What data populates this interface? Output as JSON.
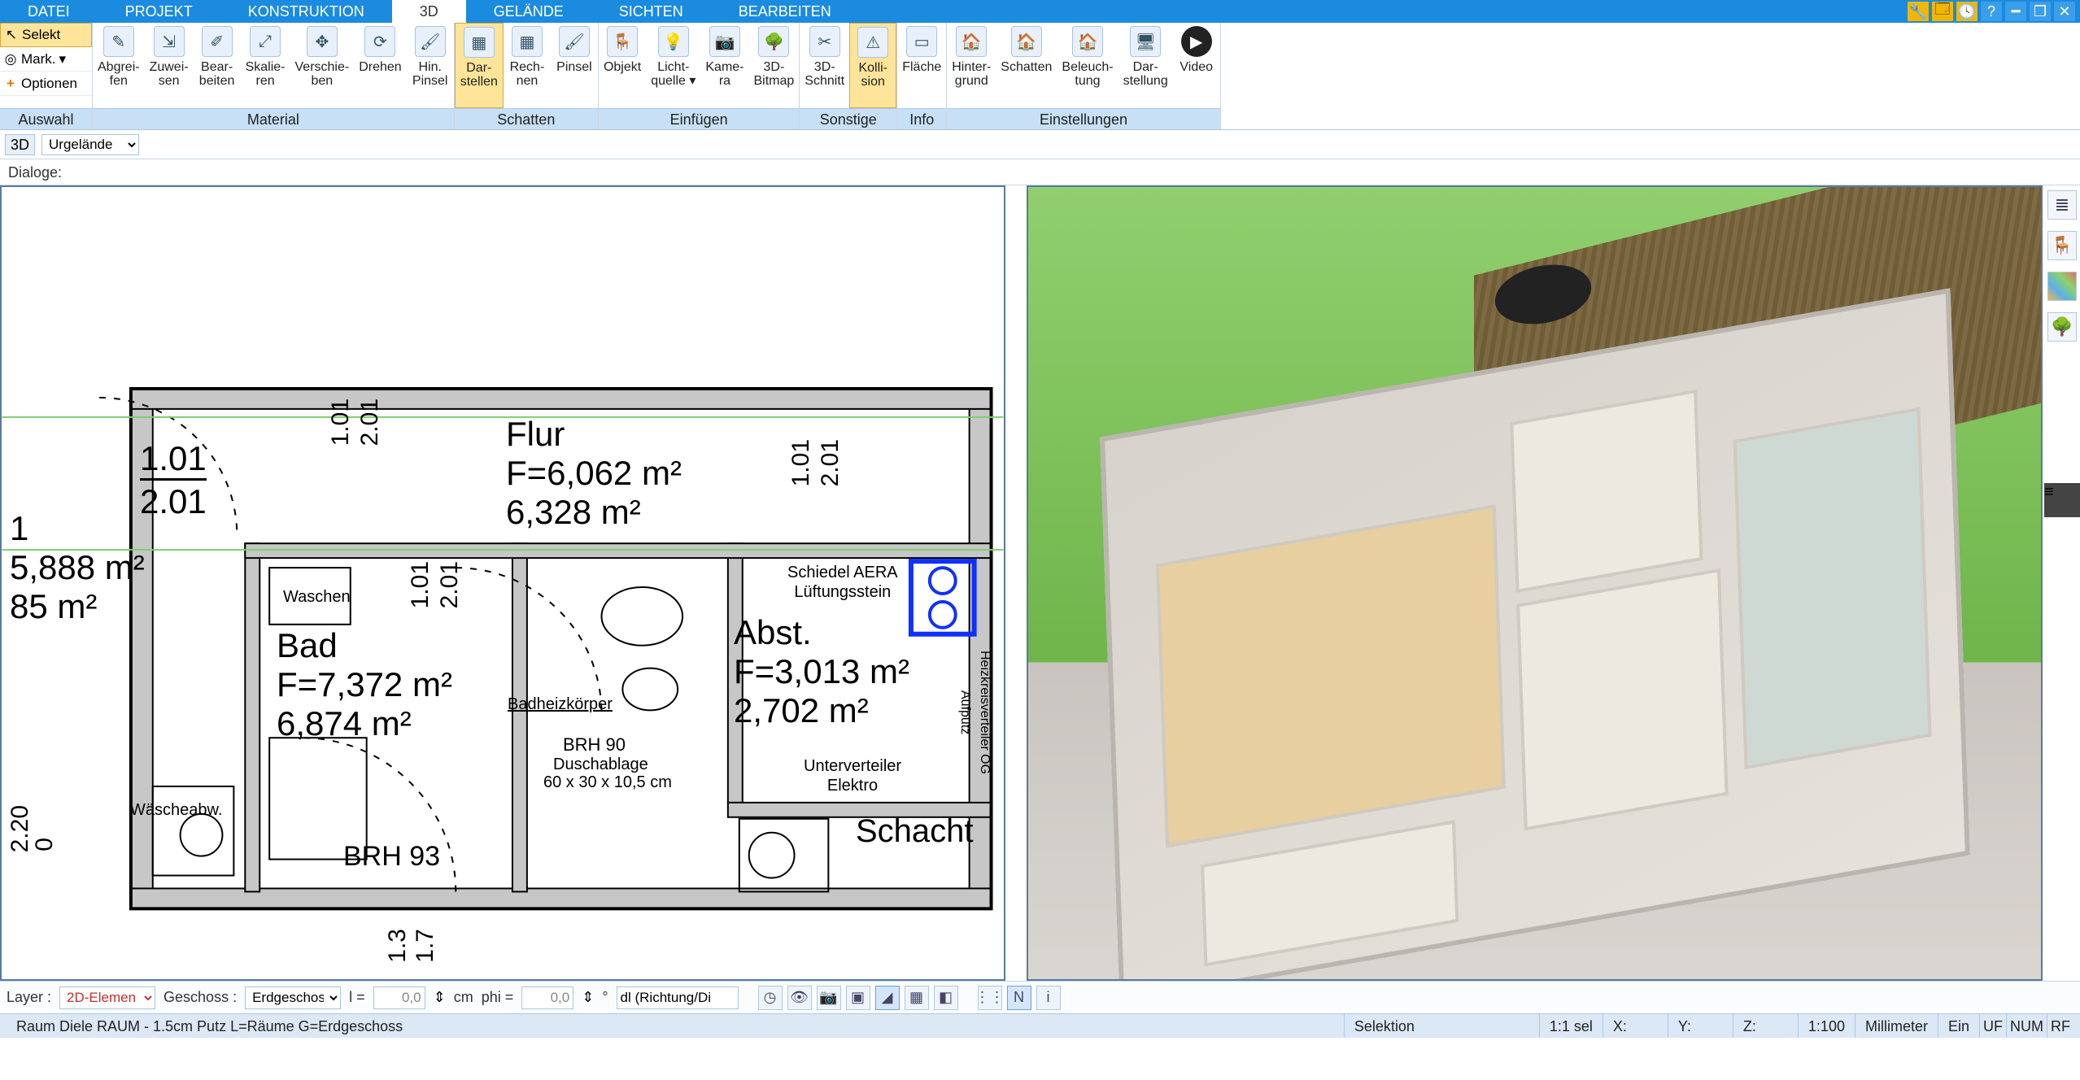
{
  "menu": {
    "tabs": [
      "DATEI",
      "PROJEKT",
      "KONSTRUKTION",
      "3D",
      "GELÄNDE",
      "SICHTEN",
      "BEARBEITEN"
    ],
    "active_index": 3
  },
  "ribbon_side": {
    "select": "Selekt",
    "mark": "Mark.",
    "optionen": "Optionen",
    "group_label": "Auswahl"
  },
  "ribbon_groups": [
    {
      "label": "Material",
      "items": [
        {
          "id": "abgreifen",
          "text": "Abgrei-\nfen"
        },
        {
          "id": "zuweisen",
          "text": "Zuwei-\nsen"
        },
        {
          "id": "bearbeiten",
          "text": "Bear-\nbeiten"
        },
        {
          "id": "skalieren",
          "text": "Skalie-\nren"
        },
        {
          "id": "verschieben",
          "text": "Verschie-\nben"
        },
        {
          "id": "drehen",
          "text": "Drehen"
        },
        {
          "id": "hinpinsel",
          "text": "Hin.\nPinsel"
        }
      ]
    },
    {
      "label": "Schatten",
      "items": [
        {
          "id": "darstellen",
          "text": "Dar-\nstellen",
          "active": true
        },
        {
          "id": "rechnen",
          "text": "Rech-\nnen"
        },
        {
          "id": "pinsel",
          "text": "Pinsel"
        }
      ]
    },
    {
      "label": "Einfügen",
      "items": [
        {
          "id": "objekt",
          "text": "Objekt"
        },
        {
          "id": "lichtquelle",
          "text": "Licht-\nquelle ▾"
        },
        {
          "id": "kamera",
          "text": "Kame-\nra"
        },
        {
          "id": "3dbitmap",
          "text": "3D-\nBitmap"
        }
      ]
    },
    {
      "label": "Sonstige",
      "items": [
        {
          "id": "3dschnitt",
          "text": "3D-\nSchnitt"
        },
        {
          "id": "kollision",
          "text": "Kolli-\nsion",
          "active": true
        }
      ]
    },
    {
      "label": "Info",
      "items": [
        {
          "id": "flaeche",
          "text": "Fläche"
        }
      ]
    },
    {
      "label": "Einstellungen",
      "items": [
        {
          "id": "hintergrund",
          "text": "Hinter-\ngrund"
        },
        {
          "id": "schatten2",
          "text": "Schatten"
        },
        {
          "id": "beleuchtung",
          "text": "Beleuch-\ntung"
        },
        {
          "id": "darstellung2",
          "text": "Dar-\nstellung"
        },
        {
          "id": "video",
          "text": "Video",
          "video": true
        }
      ]
    }
  ],
  "subbar": {
    "mode": "3D",
    "layer_select": "Urgelände"
  },
  "dialoge_label": "Dialoge:",
  "plan": {
    "rooms": {
      "flur": {
        "name": "Flur",
        "area1": "F=6,062 m²",
        "area2": "6,328 m²"
      },
      "bad": {
        "name": "Bad",
        "area1": "F=7,372 m²",
        "area2": "6,874 m²"
      },
      "abst": {
        "name": "Abst.",
        "area1": "F=3,013 m²",
        "area2": "2,702 m²"
      },
      "left": {
        "id": "1",
        "area1": "5,888 m²",
        "area2": "85 m²"
      },
      "schacht": "Schacht"
    },
    "dims": {
      "d1": "1.01",
      "d2": "2.01",
      "pair_left_top": "1.01",
      "pair_left_bot": "2.01",
      "pair_mid_top": "1.01",
      "pair_mid_bot": "2.01",
      "pair_right_top": "1.01",
      "pair_right_bot": "2.01",
      "brh93": "BRH 93",
      "left_v1": "2.20",
      "left_v2": "0",
      "bottom_v": "1.3",
      "bottom_v2": "1.7"
    },
    "notes": {
      "waschen": "Waschen",
      "waescheabw": "Wäscheabw.",
      "badheizkoerper": "Badheizkörper",
      "brh90": "BRH 90",
      "duschablage": "Duschablage",
      "duschablage_dim": "60 x 30 x 10,5 cm",
      "schiedel": "Schiedel AERA\nLüftungsstein",
      "unterverteiler": "Unterverteiler\nElektro",
      "heizkreis": "Heizkreisverteiler OG\nAufputz"
    }
  },
  "bottom": {
    "layer_label": "Layer :",
    "layer_value": "2D-Elemen",
    "geschoss_label": "Geschoss :",
    "geschoss_value": "Erdgeschos",
    "l_label": "l =",
    "l_value": "0,0",
    "l_unit": "cm",
    "phi_label": "phi =",
    "phi_value": "0,0",
    "phi_unit": "°",
    "dl_value": "dl (Richtung/Di"
  },
  "status": {
    "left": "Raum Diele RAUM - 1.5cm Putz L=Räume G=Erdgeschoss",
    "selektion": "Selektion",
    "sel": "1:1 sel",
    "x": "X:",
    "y": "Y:",
    "z": "Z:",
    "scale": "1:100",
    "unit": "Millimeter",
    "ein": "Ein",
    "uf": "UF",
    "num": "NUM",
    "rf": "RF"
  }
}
